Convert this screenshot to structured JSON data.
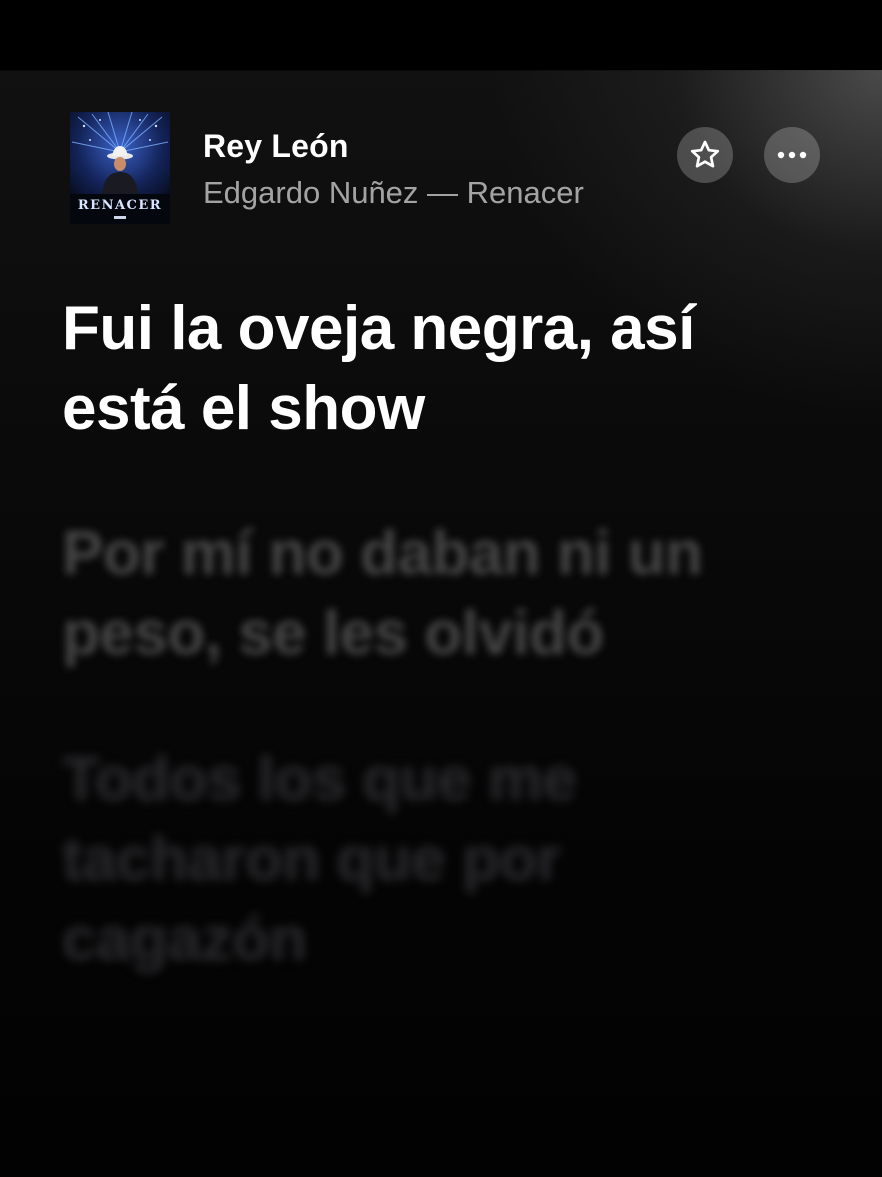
{
  "track": {
    "title": "Rey León",
    "subtitle": "Edgardo Nuñez — Renacer",
    "album_art_text": "RENACER"
  },
  "buttons": {
    "favorite_icon": "star-icon",
    "more_icon": "ellipsis-icon"
  },
  "lyrics": {
    "current": "Fui la oveja negra, así está el show",
    "upcoming": [
      "Por mí no daban ni un peso, se les olvidó",
      "Todos los que me tacharon que por cagazón"
    ]
  },
  "colors": {
    "background": "#000000",
    "active_text": "#ffffff",
    "button_bg": "rgba(255,255,255,0.22)"
  }
}
